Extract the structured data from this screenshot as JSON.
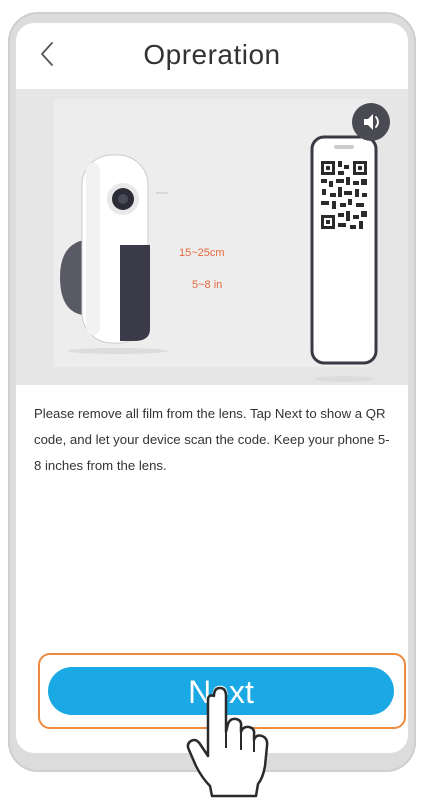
{
  "header": {
    "title": "Opreration",
    "back_icon": "chevron-left-icon"
  },
  "illustration": {
    "distance_cm": "15~25cm",
    "distance_in": "5~8 in",
    "sound_icon": "speaker-icon"
  },
  "instructions": {
    "text": "Please remove all film from the lens.  Tap Next to show a QR code, and let your device scan the code. Keep your phone 5-8 inches from the lens."
  },
  "footer": {
    "next_label": "Next",
    "pointer_icon": "hand-pointer-icon"
  },
  "colors": {
    "accent": "#1aa9e4",
    "highlight": "#ee8a3f",
    "distance_text": "#e8683d"
  }
}
